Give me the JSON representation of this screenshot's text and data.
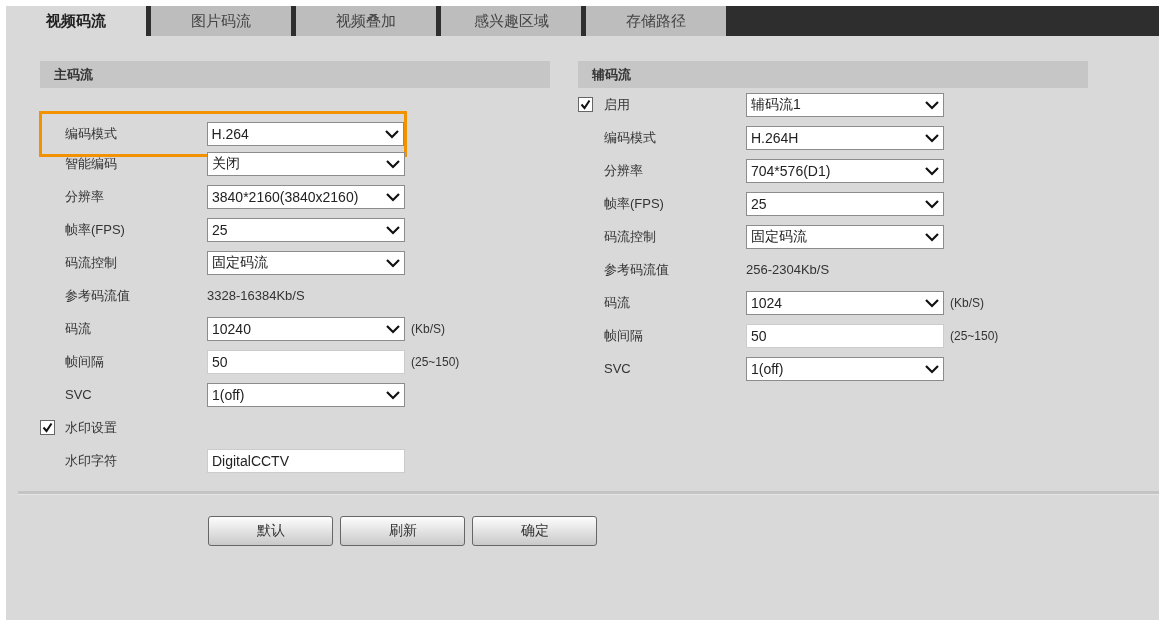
{
  "tabs": [
    {
      "label": "视频码流",
      "selected": true
    },
    {
      "label": "图片码流",
      "selected": false
    },
    {
      "label": "视频叠加",
      "selected": false
    },
    {
      "label": "感兴趣区域",
      "selected": false
    },
    {
      "label": "存储路径",
      "selected": false
    }
  ],
  "main_stream": {
    "title": "主码流",
    "rows": [
      {
        "kind": "select",
        "label": "编码模式",
        "value": "H.264",
        "highlighted": true
      },
      {
        "kind": "select",
        "label": "智能编码",
        "value": "关闭"
      },
      {
        "kind": "select",
        "label": "分辨率",
        "value": "3840*2160(3840x2160)"
      },
      {
        "kind": "select",
        "label": "帧率(FPS)",
        "value": "25"
      },
      {
        "kind": "select",
        "label": "码流控制",
        "value": "固定码流"
      },
      {
        "kind": "text",
        "label": "参考码流值",
        "value": "3328-16384Kb/S"
      },
      {
        "kind": "select",
        "label": "码流",
        "value": "10240",
        "unit": "(Kb/S)"
      },
      {
        "kind": "input",
        "label": "帧间隔",
        "value": "50",
        "unit": "(25~150)"
      },
      {
        "kind": "select",
        "label": "SVC",
        "value": "1(off)"
      },
      {
        "kind": "checkbox",
        "label": "水印设置",
        "checked": true
      },
      {
        "kind": "input",
        "label": "水印字符",
        "value": "DigitalCCTV"
      }
    ]
  },
  "sub_stream": {
    "title": "辅码流",
    "rows": [
      {
        "kind": "checkbox-select",
        "label": "启用",
        "checked": true,
        "value": "辅码流1"
      },
      {
        "kind": "select",
        "label": "编码模式",
        "value": "H.264H"
      },
      {
        "kind": "select",
        "label": "分辨率",
        "value": "704*576(D1)"
      },
      {
        "kind": "select",
        "label": "帧率(FPS)",
        "value": "25"
      },
      {
        "kind": "select",
        "label": "码流控制",
        "value": "固定码流"
      },
      {
        "kind": "text",
        "label": "参考码流值",
        "value": "256-2304Kb/S"
      },
      {
        "kind": "select",
        "label": "码流",
        "value": "1024",
        "unit": "(Kb/S)"
      },
      {
        "kind": "input",
        "label": "帧间隔",
        "value": "50",
        "unit": "(25~150)"
      },
      {
        "kind": "select",
        "label": "SVC",
        "value": "1(off)"
      }
    ]
  },
  "buttons": [
    "默认",
    "刷新",
    "确定"
  ]
}
